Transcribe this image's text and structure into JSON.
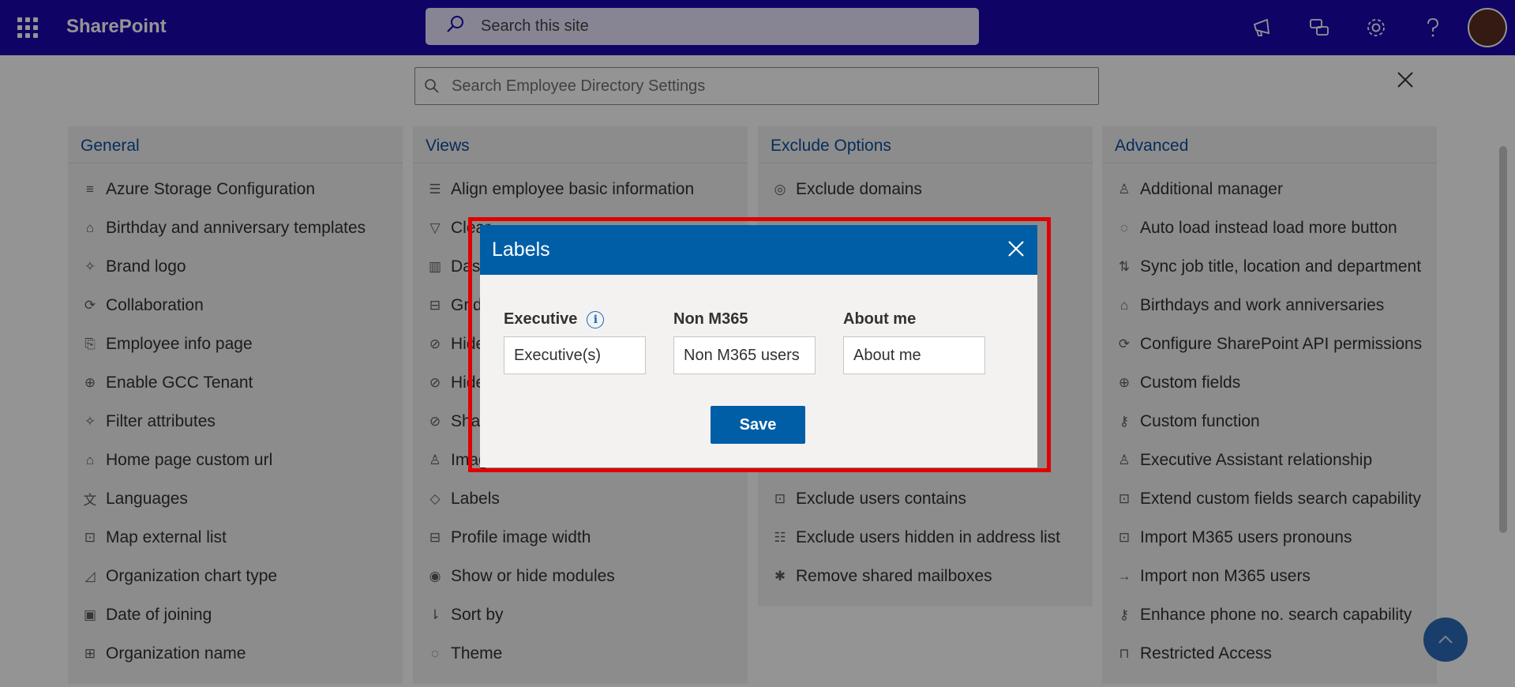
{
  "suitebar": {
    "brand": "SharePoint",
    "search_placeholder": "Search this site",
    "icons": [
      "megaphone-icon",
      "chat-feedback-icon",
      "gear-icon",
      "help-icon"
    ]
  },
  "settings": {
    "search_placeholder": "Search Employee Directory Settings",
    "columns": [
      {
        "title": "General",
        "items": [
          {
            "label": "Azure Storage Configuration",
            "icon": "≡"
          },
          {
            "label": "Birthday and anniversary templates",
            "icon": "⌂"
          },
          {
            "label": "Brand logo",
            "icon": "✧"
          },
          {
            "label": "Collaboration",
            "icon": "⟳"
          },
          {
            "label": "Employee info page",
            "icon": "⎘"
          },
          {
            "label": "Enable GCC Tenant",
            "icon": "⊕"
          },
          {
            "label": "Filter attributes",
            "icon": "✧"
          },
          {
            "label": "Home page custom url",
            "icon": "⌂"
          },
          {
            "label": "Languages",
            "icon": "文"
          },
          {
            "label": "Map external list",
            "icon": "⊡"
          },
          {
            "label": "Organization chart type",
            "icon": "◿"
          },
          {
            "label": "Date of joining",
            "icon": "▣"
          },
          {
            "label": "Organization name",
            "icon": "⊞"
          }
        ]
      },
      {
        "title": "Views",
        "items": [
          {
            "label": "Align employee basic information",
            "icon": "☰"
          },
          {
            "label": "Clear",
            "icon": "▽"
          },
          {
            "label": "Dash",
            "icon": "▥"
          },
          {
            "label": "Grid",
            "icon": "⊟"
          },
          {
            "label": "Hide",
            "icon": "⊘"
          },
          {
            "label": "Hide",
            "icon": "⊘"
          },
          {
            "label": "Share",
            "icon": "⊘"
          },
          {
            "label": "Image",
            "icon": "♙"
          },
          {
            "label": "Labels",
            "icon": "◇"
          },
          {
            "label": "Profile image width",
            "icon": "⊟"
          },
          {
            "label": "Show or hide modules",
            "icon": "◉"
          },
          {
            "label": "Sort by",
            "icon": "⇂"
          },
          {
            "label": "Theme",
            "icon": "◌"
          }
        ]
      },
      {
        "title": "Exclude Options",
        "items": [
          {
            "label": "Exclude domains",
            "icon": "◎"
          },
          {
            "label": "",
            "icon": ""
          },
          {
            "label": "",
            "icon": ""
          },
          {
            "label": "",
            "icon": ""
          },
          {
            "label": "",
            "icon": ""
          },
          {
            "label": "",
            "icon": ""
          },
          {
            "label": "",
            "icon": ""
          },
          {
            "label": "",
            "icon": ""
          },
          {
            "label": "Exclude users contains",
            "icon": "⊡"
          },
          {
            "label": "Exclude users hidden in address list",
            "icon": "☷"
          },
          {
            "label": "Remove shared mailboxes",
            "icon": "✱"
          }
        ]
      },
      {
        "title": "Advanced",
        "items": [
          {
            "label": "Additional manager",
            "icon": "♙"
          },
          {
            "label": "Auto load instead load more button",
            "icon": "◌"
          },
          {
            "label": "Sync job title, location and department",
            "icon": "⇅"
          },
          {
            "label": "Birthdays and work anniversaries",
            "icon": "⌂"
          },
          {
            "label": "Configure SharePoint API permissions",
            "icon": "⟳"
          },
          {
            "label": "Custom fields",
            "icon": "⊕"
          },
          {
            "label": "Custom function",
            "icon": "⚷"
          },
          {
            "label": "Executive Assistant relationship",
            "icon": "♙"
          },
          {
            "label": "Extend custom fields search capability",
            "icon": "⊡"
          },
          {
            "label": "Import M365 users pronouns",
            "icon": "⊡"
          },
          {
            "label": "Import non M365 users",
            "icon": "→"
          },
          {
            "label": "Enhance phone no. search capability",
            "icon": "⚷"
          },
          {
            "label": "Restricted Access",
            "icon": "⊓"
          }
        ]
      }
    ]
  },
  "dialog": {
    "title": "Labels",
    "fields": [
      {
        "label": "Executive",
        "value": "Executive(s)",
        "has_info": true
      },
      {
        "label": "Non M365",
        "value": "Non M365 users",
        "has_info": false
      },
      {
        "label": "About me",
        "value": "About me",
        "has_info": false
      }
    ],
    "save_label": "Save",
    "highlight_color": "#e00000",
    "accent_color": "#005ea7"
  }
}
